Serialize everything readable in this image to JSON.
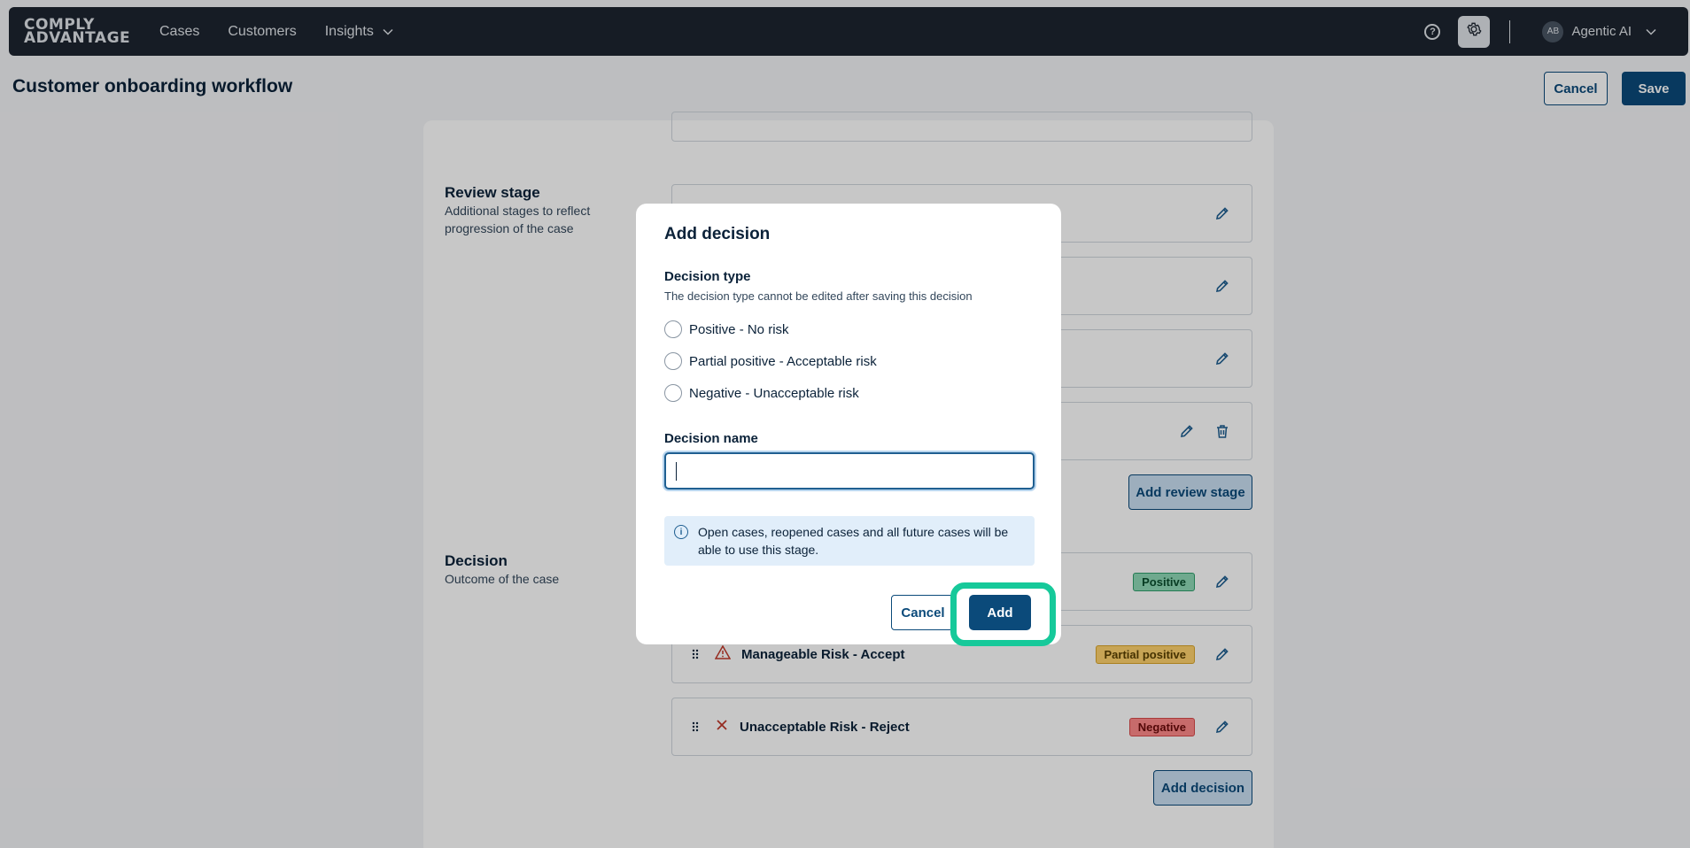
{
  "brand": {
    "line1": "COMPLY",
    "line2": "ADVANTAGE"
  },
  "nav": {
    "cases": "Cases",
    "customers": "Customers",
    "insights": "Insights"
  },
  "user": {
    "initials": "AB",
    "name": "Agentic AI"
  },
  "page": {
    "title": "Customer onboarding workflow",
    "cancel_label": "Cancel",
    "save_label": "Save"
  },
  "review_stage": {
    "title": "Review stage",
    "description": "Additional stages to reflect progression of the case",
    "add_label": "Add review stage"
  },
  "decision_section": {
    "title": "Decision",
    "description": "Outcome of the case",
    "add_label": "Add decision",
    "items": [
      {
        "name": "",
        "tag": "Positive",
        "icon": "check-icon"
      },
      {
        "name": "Manageable Risk - Accept",
        "tag": "Partial positive",
        "icon": "warning-icon"
      },
      {
        "name": "Unacceptable Risk - Reject",
        "tag": "Negative",
        "icon": "x-icon"
      }
    ]
  },
  "modal": {
    "title": "Add decision",
    "type_label": "Decision type",
    "type_hint": "The decision type cannot be edited after saving this decision",
    "options": [
      "Positive - No risk",
      "Partial positive - Acceptable risk",
      "Negative - Unacceptable risk"
    ],
    "name_label": "Decision name",
    "name_value": "",
    "info_text": "Open cases, reopened cases and all future cases will be able to use this stage.",
    "cancel_label": "Cancel",
    "add_label": "Add"
  },
  "colors": {
    "primary": "#0b4a7a",
    "topbar": "#1d2530",
    "highlight_ring": "#16c99a",
    "positive": "#8fd9b6",
    "partial": "#ffd36e",
    "negative": "#ff8a8a"
  }
}
